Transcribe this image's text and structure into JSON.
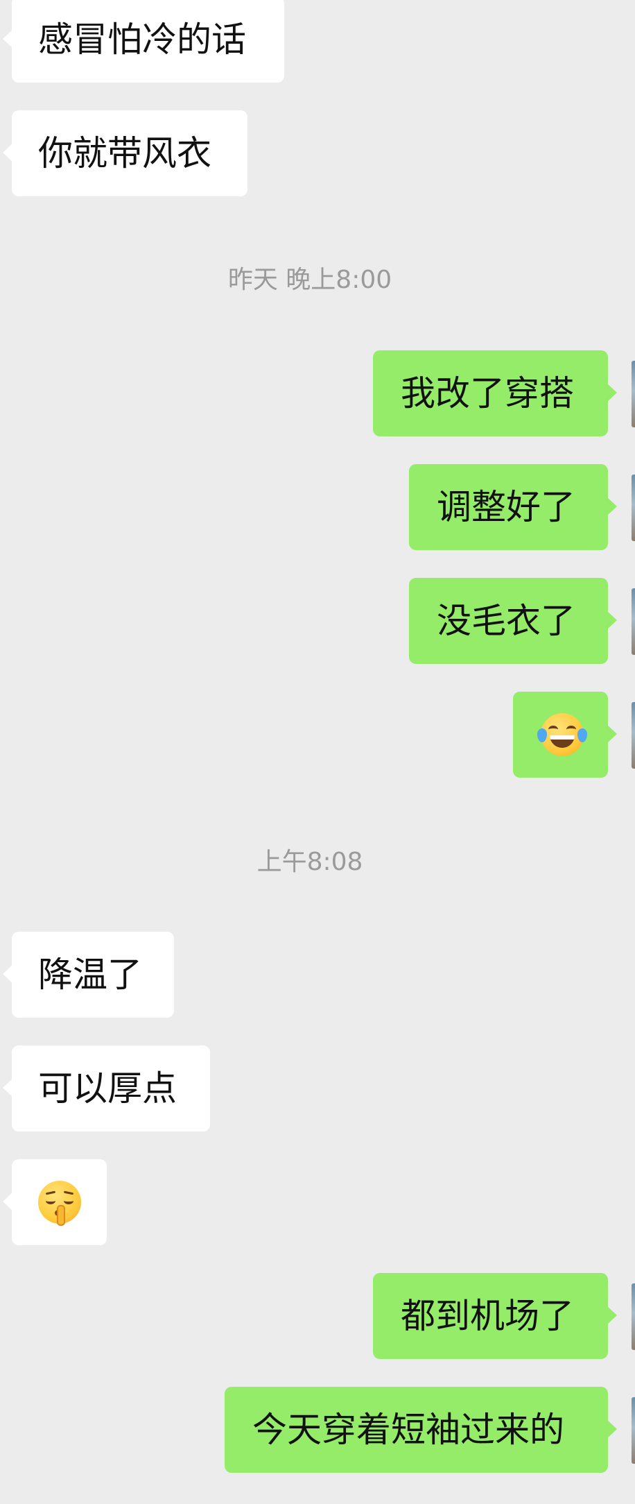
{
  "messages": [
    {
      "side": "in",
      "text": "感冒怕冷的话"
    },
    {
      "side": "in",
      "text": "你就带风衣"
    },
    {
      "type": "time",
      "text": "昨天 晚上8:00"
    },
    {
      "side": "out",
      "text": "我改了穿搭"
    },
    {
      "side": "out",
      "text": "调整好了"
    },
    {
      "side": "out",
      "text": "没毛衣了"
    },
    {
      "side": "out",
      "emoji": "laughing-crying-face-icon"
    },
    {
      "type": "time",
      "text": "上午8:08"
    },
    {
      "side": "in",
      "text": "降温了"
    },
    {
      "side": "in",
      "text": "可以厚点"
    },
    {
      "side": "in",
      "emoji": "shushing-face-icon"
    },
    {
      "side": "out",
      "text": "都到机场了"
    },
    {
      "side": "out",
      "text": "今天穿着短袖过来的"
    }
  ],
  "colors": {
    "background": "#ececec",
    "incoming_bubble": "#ffffff",
    "outgoing_bubble": "#95ec69",
    "timestamp_text": "#9a9a9a"
  }
}
